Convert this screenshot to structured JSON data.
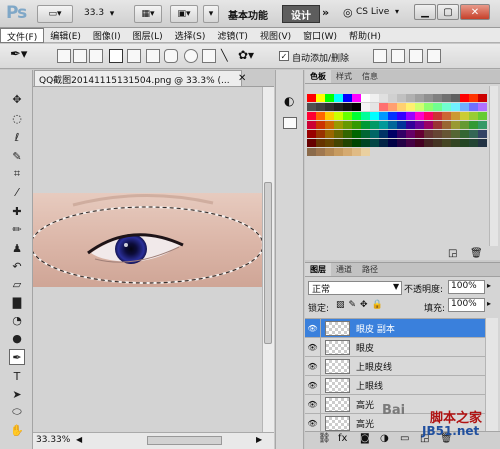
{
  "app": {
    "logo": "Ps",
    "zoom_readout": "33.3"
  },
  "workspace": {
    "basic": "基本功能",
    "design": "设计",
    "more": "»",
    "cslive": "CS Live"
  },
  "menu": {
    "items": [
      "文件(F)",
      "编辑(E)",
      "图像(I)",
      "图层(L)",
      "选择(S)",
      "滤镜(T)",
      "视图(V)",
      "窗口(W)",
      "帮助(H)"
    ]
  },
  "options": {
    "auto_add_delete": "自动添加/删除",
    "checkbox_mark": "✓"
  },
  "document": {
    "tab_title": "QQ截图20141115131504.png @ 33.3% (...",
    "zoom_status": "33.33%"
  },
  "swatches_panel": {
    "tabs": [
      "色板",
      "样式",
      "信息"
    ]
  },
  "layers_panel": {
    "tabs": [
      "图层",
      "通道",
      "路径"
    ],
    "blend_mode": "正常",
    "opacity_label": "不透明度:",
    "opacity_value": "100%",
    "lock_label": "锁定:",
    "fill_label": "填充:",
    "fill_value": "100%",
    "layers": [
      {
        "name": "眼皮 副本",
        "selected": true
      },
      {
        "name": "眼皮",
        "selected": false
      },
      {
        "name": "上眼皮线",
        "selected": false
      },
      {
        "name": "上眼线",
        "selected": false
      },
      {
        "name": "高光",
        "selected": false
      },
      {
        "name": "高光",
        "selected": false
      }
    ]
  },
  "watermark": {
    "text1": "Bai",
    "text2": "脚本之家",
    "text3": "JB51.net"
  },
  "colors": {
    "selection": "#3a80dc",
    "design_button": "#5d5d5d"
  }
}
